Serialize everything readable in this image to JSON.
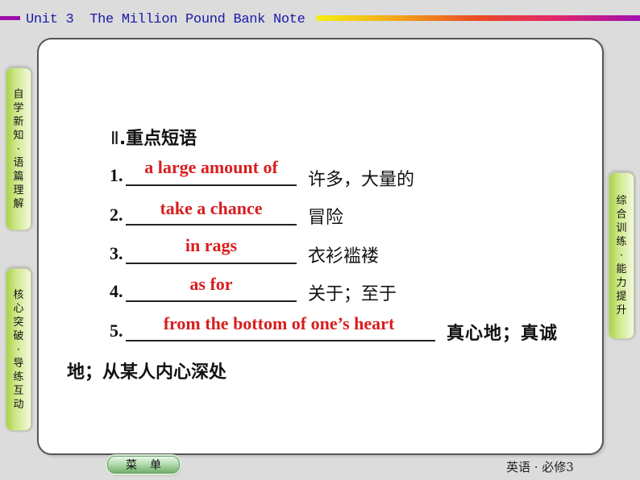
{
  "header": {
    "title": "Unit 3  The Million Pound Bank Note",
    "colors": {
      "title": "#1a1aa8",
      "bar_left": "#9b0fa6"
    }
  },
  "side_tabs": {
    "left_top": [
      "自",
      "学",
      "新",
      "知",
      "·",
      "语",
      "篇",
      "理",
      "解"
    ],
    "left_bottom": [
      "核",
      "心",
      "突",
      "破",
      "·",
      "导",
      "练",
      "互",
      "动"
    ],
    "right": [
      "综",
      "合",
      "训",
      "练",
      "·",
      "能",
      "力",
      "提",
      "升"
    ]
  },
  "section": {
    "roman": "Ⅱ",
    "title": ".重点短语"
  },
  "items": [
    {
      "num": "1.",
      "answer": "a large amount of",
      "meaning": "许多，大量的"
    },
    {
      "num": "2.",
      "answer": "take a chance",
      "meaning": "冒险"
    },
    {
      "num": "3.",
      "answer": "in rags",
      "meaning": "衣衫褴褛"
    },
    {
      "num": "4.",
      "answer": "as for",
      "meaning": "关于；至于"
    },
    {
      "num": "5.",
      "answer": "from the bottom of one’s heart",
      "meaning": "真心地；真诚",
      "meaning_cont": "地；从某人内心深处"
    }
  ],
  "footer": {
    "menu_button": [
      "菜",
      "单"
    ],
    "label": "英语 · 必修3"
  },
  "colors": {
    "answer": "#d81e1e",
    "tab_green": "#a8d14a",
    "background": "#dcdcdc"
  }
}
